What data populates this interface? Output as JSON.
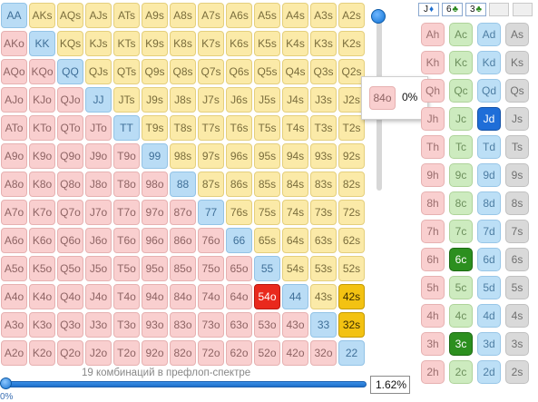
{
  "grid": {
    "rows": [
      [
        "AA",
        "AKs",
        "AQs",
        "AJs",
        "ATs",
        "A9s",
        "A8s",
        "A7s",
        "A6s",
        "A5s",
        "A4s",
        "A3s",
        "A2s"
      ],
      [
        "AKo",
        "KK",
        "KQs",
        "KJs",
        "KTs",
        "K9s",
        "K8s",
        "K7s",
        "K6s",
        "K5s",
        "K4s",
        "K3s",
        "K2s"
      ],
      [
        "AQo",
        "KQo",
        "QQ",
        "QJs",
        "QTs",
        "Q9s",
        "Q8s",
        "Q7s",
        "Q6s",
        "Q5s",
        "Q4s",
        "Q3s",
        "Q2s"
      ],
      [
        "AJo",
        "KJo",
        "QJo",
        "JJ",
        "JTs",
        "J9s",
        "J8s",
        "J7s",
        "J6s",
        "J5s",
        "J4s",
        "J3s",
        "J2s"
      ],
      [
        "ATo",
        "KTo",
        "QTo",
        "JTo",
        "TT",
        "T9s",
        "T8s",
        "T7s",
        "T6s",
        "T5s",
        "T4s",
        "T3s",
        "T2s"
      ],
      [
        "A9o",
        "K9o",
        "Q9o",
        "J9o",
        "T9o",
        "99",
        "98s",
        "97s",
        "96s",
        "95s",
        "94s",
        "93s",
        "92s"
      ],
      [
        "A8o",
        "K8o",
        "Q8o",
        "J8o",
        "T8o",
        "98o",
        "88",
        "87s",
        "86s",
        "85s",
        "84s",
        "83s",
        "82s"
      ],
      [
        "A7o",
        "K7o",
        "Q7o",
        "J7o",
        "T7o",
        "97o",
        "87o",
        "77",
        "76s",
        "75s",
        "74s",
        "73s",
        "72s"
      ],
      [
        "A6o",
        "K6o",
        "Q6o",
        "J6o",
        "T6o",
        "96o",
        "86o",
        "76o",
        "66",
        "65s",
        "64s",
        "63s",
        "62s"
      ],
      [
        "A5o",
        "K5o",
        "Q5o",
        "J5o",
        "T5o",
        "95o",
        "85o",
        "75o",
        "65o",
        "55",
        "54s",
        "53s",
        "52s"
      ],
      [
        "A4o",
        "K4o",
        "Q4o",
        "J4o",
        "T4o",
        "94o",
        "84o",
        "74o",
        "64o",
        "54o",
        "44",
        "43s",
        "42s"
      ],
      [
        "A3o",
        "K3o",
        "Q3o",
        "J3o",
        "T3o",
        "93o",
        "83o",
        "73o",
        "63o",
        "53o",
        "43o",
        "33",
        "32s"
      ],
      [
        "A2o",
        "K2o",
        "Q2o",
        "J2o",
        "T2o",
        "92o",
        "82o",
        "72o",
        "62o",
        "52o",
        "42o",
        "32o",
        "22"
      ]
    ],
    "selected": {
      "54o": "red",
      "42s": "yellow",
      "32s": "yellow"
    }
  },
  "tooltip": {
    "hand": "84o",
    "percent": "0%"
  },
  "footer": {
    "combos_label": "19 комбинаций в префлоп-спектре",
    "percent_value": "1.62%",
    "slider_label": "0%",
    "slider_value_fraction": 0
  },
  "vertical_slider": {
    "value_fraction": 1
  },
  "card_filter": {
    "buttons": [
      {
        "rank": "J",
        "suit_glyph": "♦",
        "color": "#1e6fd0"
      },
      {
        "rank": "6",
        "suit_glyph": "♣",
        "color": "#2a8a1e"
      },
      {
        "rank": "3",
        "suit_glyph": "♣",
        "color": "#2a8a1e"
      }
    ]
  },
  "card_panel": {
    "suits": [
      "h",
      "c",
      "d",
      "s"
    ],
    "ranks": [
      "A",
      "K",
      "Q",
      "J",
      "T",
      "9",
      "8",
      "7",
      "6",
      "5",
      "4",
      "3",
      "2"
    ],
    "selected": {
      "Jd": "blue",
      "6c": "green",
      "3c": "green"
    }
  },
  "colors": {
    "pair": "#b9dcf5",
    "suited": "#fbeaa8",
    "offsuit": "#f9cfcf",
    "selected_red": "#e9291d",
    "selected_yellow": "#f3c212"
  }
}
